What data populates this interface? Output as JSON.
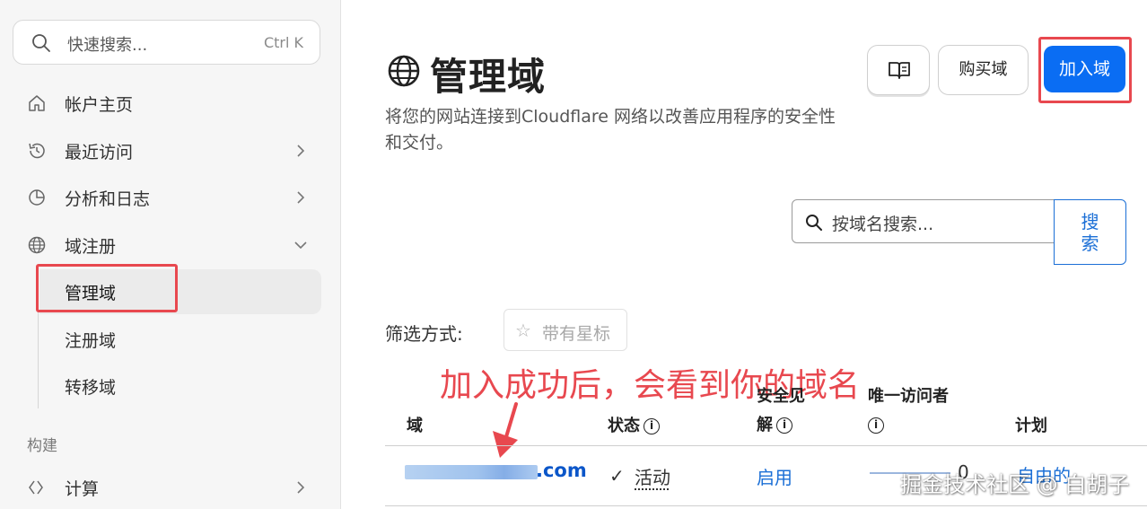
{
  "sidebar": {
    "search": {
      "placeholder": "快速搜索...",
      "shortcut": "Ctrl K"
    },
    "items": [
      {
        "label": "帐户主页",
        "icon": "home-icon",
        "has_chevron": false
      },
      {
        "label": "最近访问",
        "icon": "history-icon",
        "has_chevron": true
      },
      {
        "label": "分析和日志",
        "icon": "pie-chart-icon",
        "has_chevron": true
      },
      {
        "label": "域注册",
        "icon": "globe-icon",
        "has_chevron": true,
        "expanded": true
      }
    ],
    "sub_items": [
      {
        "label": "管理域",
        "active": true
      },
      {
        "label": "注册域",
        "active": false
      },
      {
        "label": "转移域",
        "active": false
      }
    ],
    "section": "构建",
    "build_items": [
      {
        "label": "计算",
        "icon": "code-icon",
        "has_chevron": true
      }
    ]
  },
  "main": {
    "title": "管理域",
    "description": "将您的网站连接到Cloudflare 网络以改善应用程序的安全性和交付。",
    "buttons": {
      "buy": "购买域",
      "add": "加入域"
    },
    "search": {
      "placeholder": "按域名搜索...",
      "button": "搜索"
    },
    "filter": {
      "label": "筛选方式:",
      "starred": "带有星标"
    },
    "annotation": "加入成功后，会看到你的域名",
    "table": {
      "headers": {
        "domain": "域",
        "status": "状态",
        "security_line1": "安全见",
        "security_line2": "解",
        "visitors": "唯一访问者",
        "plan": "计划"
      },
      "rows": [
        {
          "domain_tld": ".com",
          "status": "活动",
          "security": "启用",
          "visitors": "0",
          "plan": "自由的"
        }
      ]
    }
  },
  "watermark": "掘金技术社区 @ 白胡子",
  "colors": {
    "accent": "#0a6df3",
    "link": "#1b6fd6",
    "annotation": "#e8484f",
    "sidebar_bg": "#f6f6f6"
  }
}
